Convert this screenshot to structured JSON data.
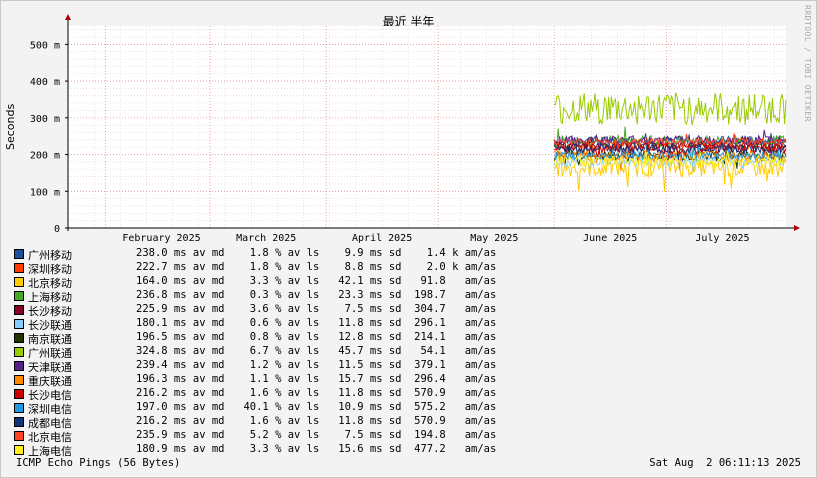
{
  "chart_data": {
    "type": "line",
    "title": "最近 半年",
    "ylabel": "Seconds",
    "ylim": [
      0,
      0.55
    ],
    "yticks": [
      {
        "value": 0,
        "label": "0"
      },
      {
        "value": 0.1,
        "label": "100 m"
      },
      {
        "value": 0.2,
        "label": "200 m"
      },
      {
        "value": 0.3,
        "label": "300 m"
      },
      {
        "value": 0.4,
        "label": "400 m"
      },
      {
        "value": 0.5,
        "label": "500 m"
      }
    ],
    "xlim": [
      "2025-01-22",
      "2025-08-02"
    ],
    "xticks": [
      {
        "date": "2025-02-01",
        "label": "February 2025"
      },
      {
        "date": "2025-03-01",
        "label": "March 2025"
      },
      {
        "date": "2025-04-01",
        "label": "April 2025"
      },
      {
        "date": "2025-05-01",
        "label": "May 2025"
      },
      {
        "date": "2025-06-01",
        "label": "June 2025"
      },
      {
        "date": "2025-07-01",
        "label": "July 2025"
      }
    ],
    "data_start": "2025-06-01",
    "grid": true,
    "series": [
      {
        "name": "广州移动",
        "color": "#1f4e9a",
        "avg": 0.238,
        "spread": 0.012
      },
      {
        "name": "深圳移动",
        "color": "#ff3c00",
        "avg": 0.2227,
        "spread": 0.01
      },
      {
        "name": "北京移动",
        "color": "#ffcc00",
        "avg": 0.164,
        "spread": 0.025
      },
      {
        "name": "上海移动",
        "color": "#44aa22",
        "avg": 0.2368,
        "spread": 0.015
      },
      {
        "name": "长沙移动",
        "color": "#880022",
        "avg": 0.2259,
        "spread": 0.009
      },
      {
        "name": "长沙联通",
        "color": "#88ccff",
        "avg": 0.1801,
        "spread": 0.012
      },
      {
        "name": "南京联通",
        "color": "#223300",
        "avg": 0.1965,
        "spread": 0.014
      },
      {
        "name": "广州联通",
        "color": "#99cc00",
        "avg": 0.3248,
        "spread": 0.045
      },
      {
        "name": "天津联通",
        "color": "#552288",
        "avg": 0.2394,
        "spread": 0.012
      },
      {
        "name": "重庆联通",
        "color": "#ff8800",
        "avg": 0.1963,
        "spread": 0.015
      },
      {
        "name": "长沙电信",
        "color": "#cc0000",
        "avg": 0.2162,
        "spread": 0.012
      },
      {
        "name": "深圳电信",
        "color": "#2299dd",
        "avg": 0.197,
        "spread": 0.011
      },
      {
        "name": "成都电信",
        "color": "#113377",
        "avg": 0.2162,
        "spread": 0.012
      },
      {
        "name": "北京电信",
        "color": "#ff4422",
        "avg": 0.2359,
        "spread": 0.008
      },
      {
        "name": "上海电信",
        "color": "#ffee22",
        "avg": 0.1809,
        "spread": 0.016
      }
    ]
  },
  "legend": [
    {
      "name": "广州移动",
      "color": "#1f4e9a",
      "stats": "238.0 ms av md    1.8 % av ls    9.9 ms sd    1.4 k am/as"
    },
    {
      "name": "深圳移动",
      "color": "#ff3c00",
      "stats": "222.7 ms av md    1.8 % av ls    8.8 ms sd    2.0 k am/as"
    },
    {
      "name": "北京移动",
      "color": "#ffcc00",
      "stats": "164.0 ms av md    3.3 % av ls   42.1 ms sd   91.8   am/as"
    },
    {
      "name": "上海移动",
      "color": "#44aa22",
      "stats": "236.8 ms av md    0.3 % av ls   23.3 ms sd  198.7   am/as"
    },
    {
      "name": "长沙移动",
      "color": "#880022",
      "stats": "225.9 ms av md    3.6 % av ls    7.5 ms sd  304.7   am/as"
    },
    {
      "name": "长沙联通",
      "color": "#88ccff",
      "stats": "180.1 ms av md    0.6 % av ls   11.8 ms sd  296.1   am/as"
    },
    {
      "name": "南京联通",
      "color": "#223300",
      "stats": "196.5 ms av md    0.8 % av ls   12.8 ms sd  214.1   am/as"
    },
    {
      "name": "广州联通",
      "color": "#99cc00",
      "stats": "324.8 ms av md    6.7 % av ls   45.7 ms sd   54.1   am/as"
    },
    {
      "name": "天津联通",
      "color": "#552288",
      "stats": "239.4 ms av md    1.2 % av ls   11.5 ms sd  379.1   am/as"
    },
    {
      "name": "重庆联通",
      "color": "#ff8800",
      "stats": "196.3 ms av md    1.1 % av ls   15.7 ms sd  296.4   am/as"
    },
    {
      "name": "长沙电信",
      "color": "#cc0000",
      "stats": "216.2 ms av md    1.6 % av ls   11.8 ms sd  570.9   am/as"
    },
    {
      "name": "深圳电信",
      "color": "#2299dd",
      "stats": "197.0 ms av md   40.1 % av ls   10.9 ms sd  575.2   am/as"
    },
    {
      "name": "成都电信",
      "color": "#113377",
      "stats": "216.2 ms av md    1.6 % av ls   11.8 ms sd  570.9   am/as"
    },
    {
      "name": "北京电信",
      "color": "#ff4422",
      "stats": "235.9 ms av md    5.2 % av ls    7.5 ms sd  194.8   am/as"
    },
    {
      "name": "上海电信",
      "color": "#ffee22",
      "stats": "180.9 ms av md    3.3 % av ls   15.6 ms sd  477.2   am/as"
    }
  ],
  "footer": {
    "left": "ICMP Echo Pings (56 Bytes)",
    "right": "Sat Aug  2 06:11:13 2025"
  },
  "watermark": "RRDTOOL / TOBI OETIKER"
}
